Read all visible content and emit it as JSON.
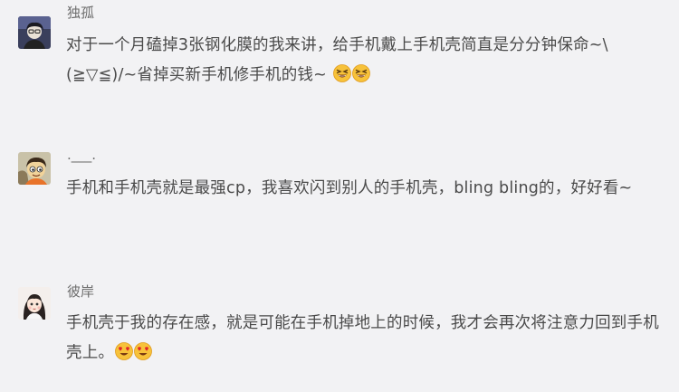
{
  "comments": [
    {
      "username": "独孤",
      "text": "对于一个月磕掉3张钢化膜的我来讲，给手机戴上手机壳简直是分分钟保命~\\(≧▽≦)/~省掉买新手机修手机的钱~ ",
      "emojis": [
        "grinning-squint-face",
        "grinning-squint-face"
      ]
    },
    {
      "username": ".___.",
      "text": "手机和手机壳就是最强cp，我喜欢闪到别人的手机壳，bling bling的，好好看~",
      "emojis": []
    },
    {
      "username": "彼岸",
      "text": "手机壳于我的存在感，就是可能在手机掉地上的时候，我才会再次将注意力回到手机壳上。",
      "emojis": [
        "heart-eyes-face",
        "heart-eyes-face"
      ]
    }
  ]
}
